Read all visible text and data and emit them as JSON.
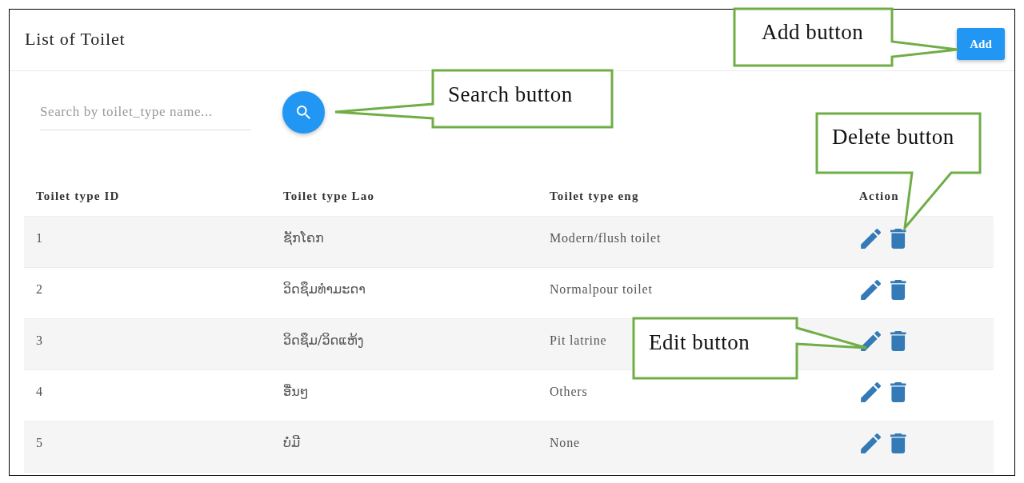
{
  "header": {
    "title": "List of Toilet",
    "add_button": "Add"
  },
  "search": {
    "placeholder": "Search by toilet_type name..."
  },
  "table": {
    "columns": [
      "Toilet type ID",
      "Toilet type Lao",
      "Toilet type eng",
      "Action"
    ],
    "rows": [
      {
        "id": "1",
        "lao": "ຊັກໂຄກ",
        "eng": "Modern/flush toilet"
      },
      {
        "id": "2",
        "lao": "ວິດຊຶມທຳມະດາ",
        "eng": "Normalpour toilet"
      },
      {
        "id": "3",
        "lao": "ວິດຊຶມ/ວິດແຫ້ງ",
        "eng": "Pit latrine"
      },
      {
        "id": "4",
        "lao": "ອື່ນໆ",
        "eng": "Others"
      },
      {
        "id": "5",
        "lao": "ບໍ່ມີ",
        "eng": "None"
      }
    ]
  },
  "callouts": [
    {
      "text": "Add button"
    },
    {
      "text": "Search button"
    },
    {
      "text": "Delete button"
    },
    {
      "text": "Edit button"
    }
  ]
}
